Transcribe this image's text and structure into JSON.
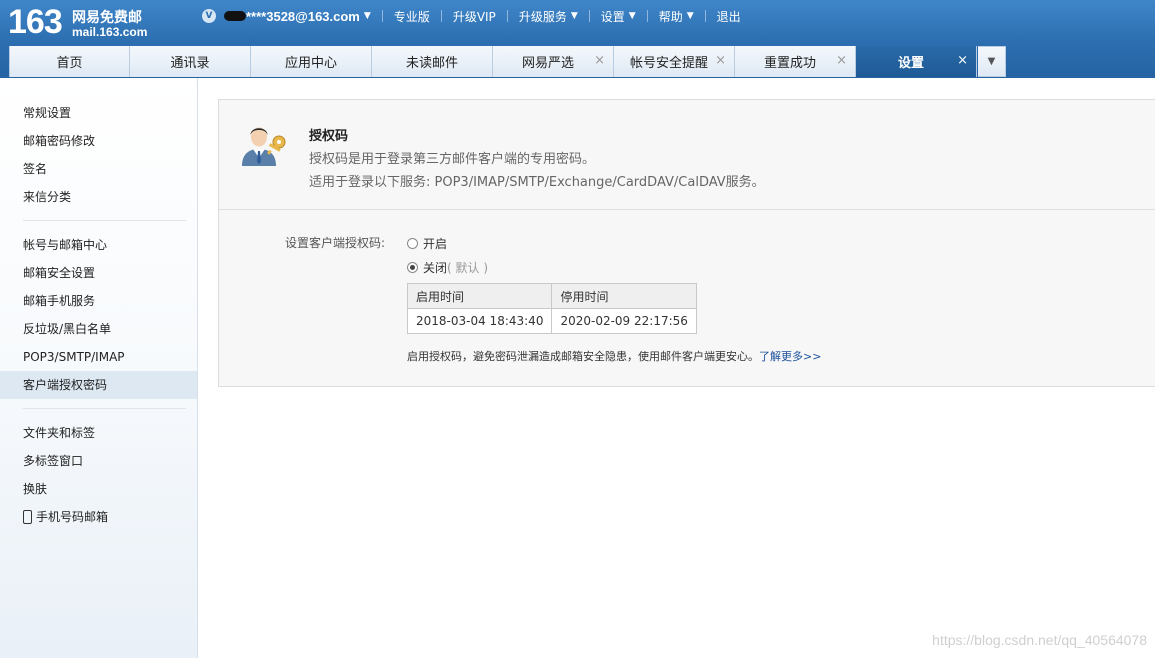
{
  "logo": {
    "number": "163",
    "cn": "网易免费邮",
    "domain": "mail.163.com"
  },
  "topnav": {
    "badge": "V",
    "account": "****3528@163.com",
    "items": [
      "专业版",
      "升级VIP",
      "升级服务",
      "设置",
      "帮助",
      "退出"
    ]
  },
  "tabs": [
    {
      "label": "首页"
    },
    {
      "label": "通讯录"
    },
    {
      "label": "应用中心"
    },
    {
      "label": "未读邮件"
    },
    {
      "label": "网易严选",
      "close": "×"
    },
    {
      "label": "帐号安全提醒",
      "close": "×"
    },
    {
      "label": "重置成功",
      "close": "×"
    },
    {
      "label": "设置",
      "close": "×",
      "active": true
    }
  ],
  "sidebar": {
    "group1": [
      "常规设置",
      "邮箱密码修改",
      "签名",
      "来信分类"
    ],
    "group2": [
      "帐号与邮箱中心",
      "邮箱安全设置",
      "邮箱手机服务",
      "反垃圾/黑白名单",
      "POP3/SMTP/IMAP",
      "客户端授权密码"
    ],
    "group3": [
      "文件夹和标签",
      "多标签窗口",
      "换肤",
      "手机号码邮箱"
    ]
  },
  "panel": {
    "title": "授权码",
    "desc1": "授权码是用于登录第三方邮件客户端的专用密码。",
    "desc2": "适用于登录以下服务: POP3/IMAP/SMTP/Exchange/CardDAV/CalDAV服务。",
    "setting_label": "设置客户端授权码:",
    "option_on": "开启",
    "option_off": "关闭",
    "option_off_note": "( 默认 )",
    "table": {
      "headers": [
        "启用时间",
        "停用时间"
      ],
      "row": [
        "2018-03-04 18:43:40",
        "2020-02-09 22:17:56"
      ]
    },
    "tip": "启用授权码，避免密码泄漏造成邮箱安全隐患，使用邮件客户端更安心。",
    "tip_link": "了解更多>>"
  },
  "watermark": "https://blog.csdn.net/qq_40564078",
  "colors": {
    "topbar": "#2c6eb0",
    "active_tab": "#1e5a96",
    "link": "#1b4f9c"
  }
}
